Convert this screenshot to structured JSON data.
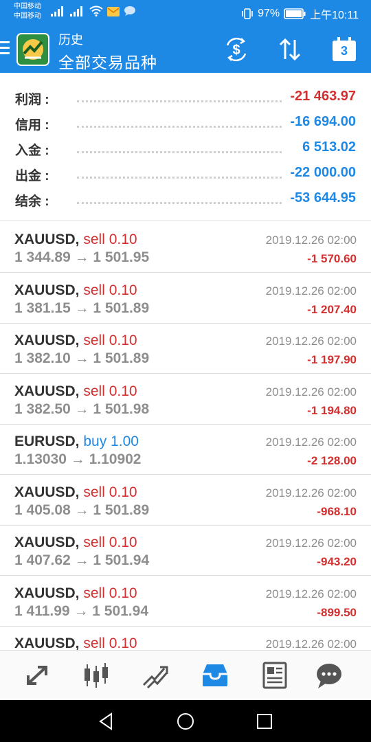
{
  "status_bar": {
    "carrier1": "中国移动",
    "carrier2": "中国移动",
    "network1": "2G",
    "network2": "4G",
    "battery": "97%",
    "time": "上午10:11"
  },
  "header": {
    "subtitle": "历史",
    "title": "全部交易品种",
    "icons": [
      "dollar-exchange-icon",
      "sort-icon",
      "calendar-icon"
    ],
    "calendar_day": "3"
  },
  "summary": [
    {
      "label": "利润 :",
      "value": "-21 463.97",
      "color": "#d32f2f"
    },
    {
      "label": "信用 :",
      "value": "-16 694.00",
      "color": "#1e88e5"
    },
    {
      "label": "入金 :",
      "value": "6 513.02",
      "color": "#1e88e5"
    },
    {
      "label": "出金 :",
      "value": "-22 000.00",
      "color": "#1e88e5"
    },
    {
      "label": "结余 :",
      "value": "-53 644.95",
      "color": "#1e88e5"
    }
  ],
  "deals": [
    {
      "symbol": "XAUUSD,",
      "side": "sell 0.10",
      "side_color": "#d32f2f",
      "prices": "1 344.89 → 1 501.95",
      "time": "2019.12.26 02:00",
      "profit": "-1 570.60"
    },
    {
      "symbol": "XAUUSD,",
      "side": "sell 0.10",
      "side_color": "#d32f2f",
      "prices": "1 381.15 → 1 501.89",
      "time": "2019.12.26 02:00",
      "profit": "-1 207.40"
    },
    {
      "symbol": "XAUUSD,",
      "side": "sell 0.10",
      "side_color": "#d32f2f",
      "prices": "1 382.10 → 1 501.89",
      "time": "2019.12.26 02:00",
      "profit": "-1 197.90"
    },
    {
      "symbol": "XAUUSD,",
      "side": "sell 0.10",
      "side_color": "#d32f2f",
      "prices": "1 382.50 → 1 501.98",
      "time": "2019.12.26 02:00",
      "profit": "-1 194.80"
    },
    {
      "symbol": "EURUSD,",
      "side": "buy 1.00",
      "side_color": "#1e88e5",
      "prices": "1.13030 → 1.10902",
      "time": "2019.12.26 02:00",
      "profit": "-2 128.00"
    },
    {
      "symbol": "XAUUSD,",
      "side": "sell 0.10",
      "side_color": "#d32f2f",
      "prices": "1 405.08 → 1 501.89",
      "time": "2019.12.26 02:00",
      "profit": "-968.10"
    },
    {
      "symbol": "XAUUSD,",
      "side": "sell 0.10",
      "side_color": "#d32f2f",
      "prices": "1 407.62 → 1 501.94",
      "time": "2019.12.26 02:00",
      "profit": "-943.20"
    },
    {
      "symbol": "XAUUSD,",
      "side": "sell 0.10",
      "side_color": "#d32f2f",
      "prices": "1 411.99 → 1 501.94",
      "time": "2019.12.26 02:00",
      "profit": "-899.50"
    },
    {
      "symbol": "XAUUSD,",
      "side": "sell 0.10",
      "side_color": "#d32f2f",
      "prices": "",
      "time": "2019.12.26 02:00",
      "profit": ""
    }
  ],
  "bottom_nav": {
    "items": [
      "quotes-icon",
      "chart-icon",
      "trade-icon",
      "history-icon",
      "news-icon",
      "chat-icon"
    ],
    "active": "history-icon",
    "active_color": "#1e88e5",
    "inactive_color": "#555555"
  },
  "system_nav": [
    "back-icon",
    "home-icon",
    "recents-icon"
  ]
}
